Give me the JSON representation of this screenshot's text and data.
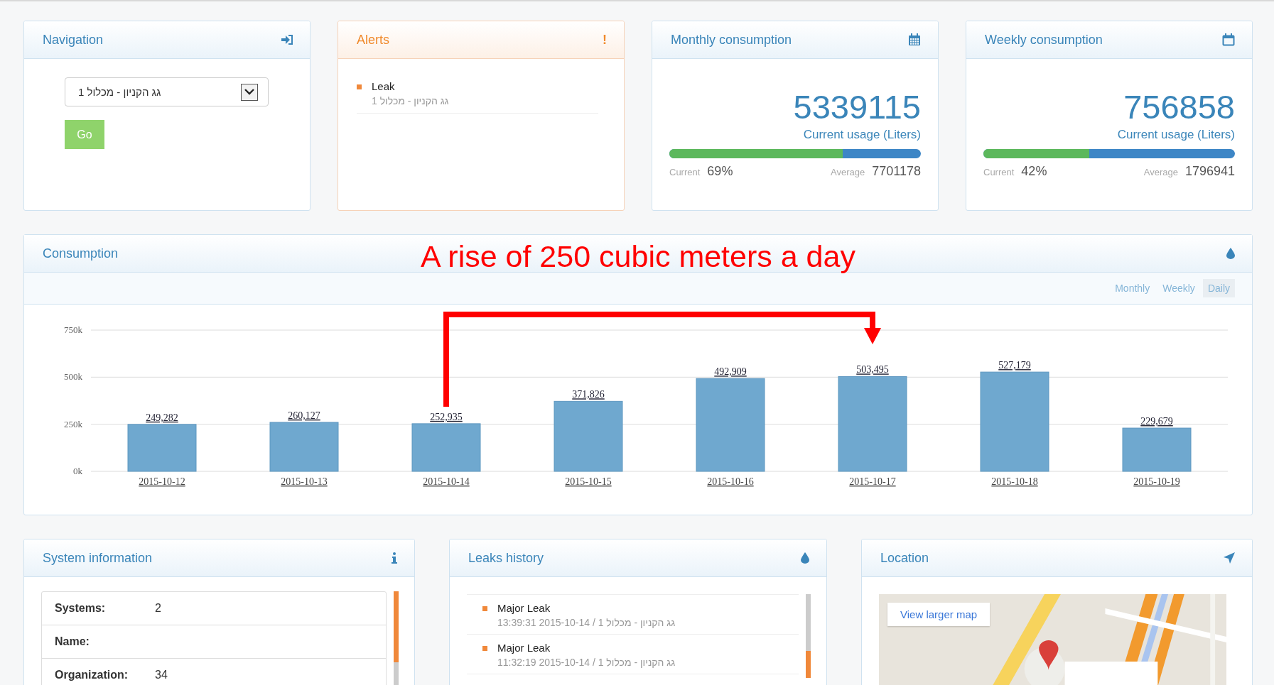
{
  "navigation": {
    "title": "Navigation",
    "select_value": "גג הקניון - מכלול 1",
    "go_label": "Go"
  },
  "alerts": {
    "title": "Alerts",
    "icon_text": "!",
    "items": [
      {
        "title": "Leak",
        "subtitle": "גג הקניון - מכלול 1"
      }
    ]
  },
  "usage_cards": [
    {
      "title": "Monthly consumption",
      "value": "5339115",
      "caption": "Current usage (Liters)",
      "level": 0.69,
      "current_label": "Current",
      "current_value": "69%",
      "average_label": "Average",
      "average_value": "7701178"
    },
    {
      "title": "Weekly consumption",
      "value": "756858",
      "caption": "Current usage (Liters)",
      "level": 0.42,
      "current_label": "Current",
      "current_value": "42%",
      "average_label": "Average",
      "average_value": "1796941"
    }
  ],
  "consumption": {
    "title": "Consumption",
    "annotation": "A rise of 250 cubic meters a day",
    "tabs": [
      {
        "label": "Monthly",
        "selected": false
      },
      {
        "label": "Weekly",
        "selected": false
      },
      {
        "label": "Daily",
        "selected": true
      }
    ],
    "chart_data": {
      "type": "bar",
      "categories": [
        "2015-10-12",
        "2015-10-13",
        "2015-10-14",
        "2015-10-15",
        "2015-10-16",
        "2015-10-17",
        "2015-10-18",
        "2015-10-19"
      ],
      "series": [
        {
          "color": "#6fa8cf",
          "values": [
            249282,
            260127,
            252935,
            371826,
            492909,
            503495,
            527179,
            229679
          ]
        }
      ],
      "ylim": [
        0,
        750000
      ],
      "yticks": [
        {
          "value": 0,
          "label": "0k"
        },
        {
          "value": 250000,
          "label": "250k"
        },
        {
          "value": 500000,
          "label": "500k"
        },
        {
          "value": 750000,
          "label": "750k"
        }
      ],
      "value_labels": [
        "249,282",
        "260,127",
        "252,935",
        "371,826",
        "492,909",
        "503,495",
        "527,179",
        "229,679"
      ]
    }
  },
  "system_information": {
    "title": "System information",
    "rows": [
      {
        "label": "Systems:",
        "value": "2"
      },
      {
        "label": "Name:"
      },
      {
        "label": "Organization:",
        "value": "34"
      }
    ]
  },
  "leaks_history": {
    "title": "Leaks history",
    "items": [
      {
        "title": "Major Leak",
        "detail": "גג הקניון - מכלול 1 / 2015-10-14 13:39:31"
      },
      {
        "title": "Major Leak",
        "detail": "גג הקניון - מכלול 1 / 2015-10-14 11:32:19"
      }
    ]
  },
  "location": {
    "title": "Location",
    "map_button": "View larger map"
  }
}
